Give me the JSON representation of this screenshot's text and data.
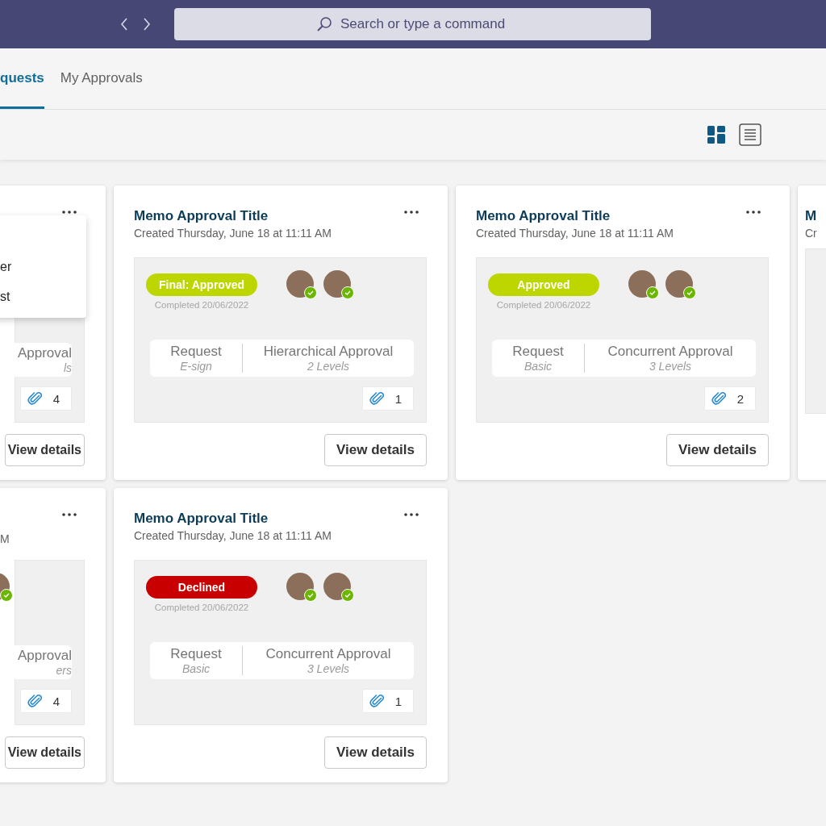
{
  "top_bar": {
    "search": {
      "placeholder": "Search or type a command"
    }
  },
  "tabs": [
    {
      "label": "quests",
      "selected": true
    },
    {
      "label": "My Approvals",
      "selected": false
    }
  ],
  "view_toggle": [
    {
      "kind": "grid",
      "selected": true
    },
    {
      "kind": "list",
      "selected": false
    }
  ],
  "cards": [
    {
      "kind": "partial-left",
      "menu": {
        "items": [
          {
            "label": "er"
          },
          {
            "label": "st"
          }
        ]
      },
      "approval": "Approval",
      "approval_detail": "ls",
      "attachments": "4",
      "button": "View details"
    },
    {
      "kind": "full",
      "title": "Memo Approval Title",
      "subtitle": "Created Thursday, June 18 at 11:11 AM",
      "status": {
        "label": "Final: Approved",
        "color": "#bdd600"
      },
      "completed": "Completed 20/06/2022",
      "approvers": [
        {
          "approved": true
        },
        {
          "approved": true
        }
      ],
      "request": "Request",
      "request_type": "E-sign",
      "approval": "Hierarchical Approval",
      "approval_detail": "2 Levels",
      "attachments": "1",
      "button": "View details"
    },
    {
      "kind": "full",
      "title": "Memo Approval Title",
      "subtitle": "Created Thursday, June 18 at 11:11 AM",
      "status": {
        "label": "Approved",
        "color": "#bdd600"
      },
      "completed": "Completed 20/06/2022",
      "approvers": [
        {
          "approved": true
        },
        {
          "approved": true
        }
      ],
      "request": "Request",
      "request_type": "Basic",
      "approval": "Concurrent Approval",
      "approval_detail": "3 Levels",
      "attachments": "2",
      "button": "View details"
    },
    {
      "kind": "partial-right",
      "title": "M",
      "subtitle": "Cr"
    },
    {
      "kind": "partial-left",
      "subtitle": "M",
      "approvers": [
        {
          "approved": true
        }
      ],
      "approval": "Approval",
      "approval_detail": "ers",
      "attachments": "4",
      "button": "View details"
    },
    {
      "kind": "full",
      "title": "Memo Approval Title",
      "subtitle": "Created Thursday, June 18 at 11:11 AM",
      "status": {
        "label": "Declined",
        "color": "#c80000"
      },
      "completed": "Completed 20/06/2022",
      "approvers": [
        {
          "approved": true
        },
        {
          "approved": true
        }
      ],
      "request": "Request",
      "request_type": "Basic",
      "approval": "Concurrent Approval",
      "approval_detail": "3 Levels",
      "attachments": "1",
      "button": "View details"
    }
  ]
}
